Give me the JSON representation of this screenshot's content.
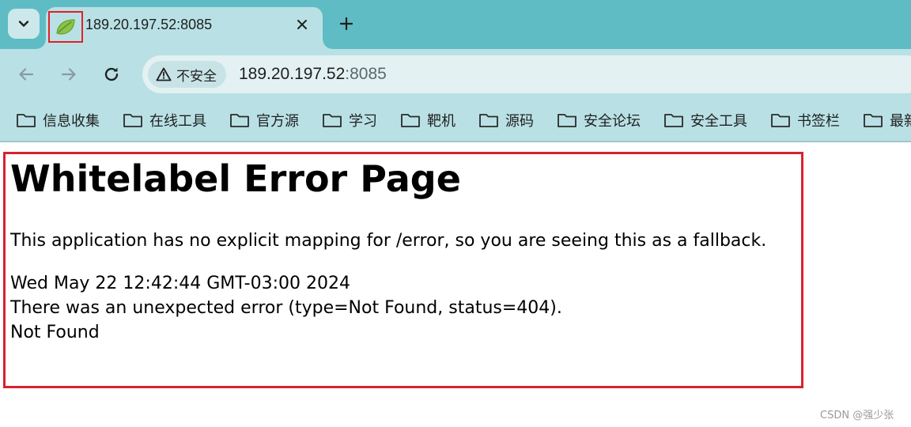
{
  "tab": {
    "title": "189.20.197.52:8085",
    "favicon": "spring-leaf-icon",
    "close_icon": "close-icon"
  },
  "toolbar": {
    "back_icon": "arrow-left-icon",
    "forward_icon": "arrow-right-icon",
    "reload_icon": "reload-icon",
    "security_label": "不安全",
    "url_host": "189.20.197.52",
    "url_port": ":8085"
  },
  "bookmarks": [
    {
      "label": "信息收集"
    },
    {
      "label": "在线工具"
    },
    {
      "label": "官方源"
    },
    {
      "label": "学习"
    },
    {
      "label": "靶机"
    },
    {
      "label": "源码"
    },
    {
      "label": "安全论坛"
    },
    {
      "label": "安全工具"
    },
    {
      "label": "书签栏"
    },
    {
      "label": "最新"
    }
  ],
  "page": {
    "heading": "Whitelabel Error Page",
    "description": "This application has no explicit mapping for /error, so you are seeing this as a fallback.",
    "timestamp": "Wed May 22 12:42:44 GMT-03:00 2024",
    "error_detail": "There was an unexpected error (type=Not Found, status=404).",
    "error_message": "Not Found"
  },
  "watermark": "CSDN @强少张",
  "colors": {
    "tabstrip": "#5fbcc4",
    "toolbar": "#b9e1e5",
    "highlight_border": "#d7232f"
  }
}
